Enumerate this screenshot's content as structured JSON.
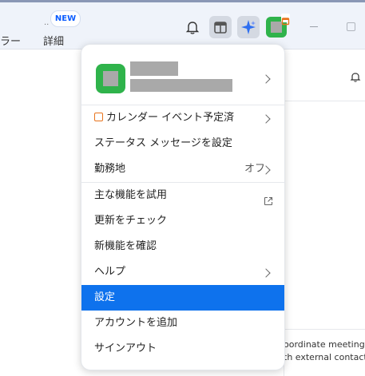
{
  "header": {
    "left_label": "ラー",
    "detail_label": "詳細",
    "new_badge": "NEW",
    "new_dots": ".."
  },
  "menu": {
    "items": [
      {
        "label": "カレンダー イベント予定済"
      },
      {
        "label": "ステータス メッセージを設定"
      },
      {
        "label": "勤務地",
        "value": "オフ"
      },
      {
        "label": "主な機能を試用"
      },
      {
        "label": "更新をチェック"
      },
      {
        "label": "新機能を確認"
      },
      {
        "label": "ヘルプ"
      },
      {
        "label": "設定"
      },
      {
        "label": "アカウントを追加"
      },
      {
        "label": "サインアウト"
      }
    ]
  },
  "right_panel": {
    "banner_line1": "oordinate meetings",
    "banner_line2": "th external contact"
  },
  "colors": {
    "selected": "#0e72ed",
    "avatar": "#2fb34b",
    "calendar_accent": "#e8731c"
  }
}
